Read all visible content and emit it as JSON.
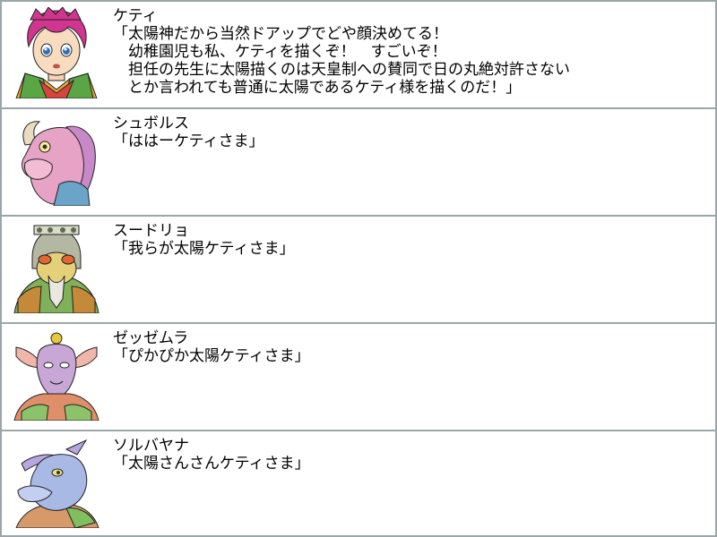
{
  "dialogue_log": [
    {
      "speaker": "ケティ",
      "portrait_icon": "keti-portrait-icon",
      "lines": [
        "「太陽神だから当然ドアップでどや顔決めてる！",
        "　幼稚園児も私、ケティを描くぞ！　すごいぞ！",
        "　担任の先生に太陽描くのは天皇制への賛同で日の丸絶対許さない",
        "　とか言われても普通に太陽であるケティ様を描くのだ！」"
      ]
    },
    {
      "speaker": "シュボルス",
      "portrait_icon": "shuborusu-portrait-icon",
      "lines": [
        "「ははーケティさま」"
      ]
    },
    {
      "speaker": "スードリョ",
      "portrait_icon": "suudoryo-portrait-icon",
      "lines": [
        "「我らが太陽ケティさま」"
      ]
    },
    {
      "speaker": "ゼッゼムラ",
      "portrait_icon": "zezzemura-portrait-icon",
      "lines": [
        "「ぴかぴか太陽ケティさま」"
      ]
    },
    {
      "speaker": "ソルバヤナ",
      "portrait_icon": "sorubayana-portrait-icon",
      "lines": [
        "「太陽さんさんケティさま」"
      ]
    }
  ],
  "colors": {
    "border": "#9aa6a8",
    "background": "#ffffff",
    "text": "#000000"
  }
}
